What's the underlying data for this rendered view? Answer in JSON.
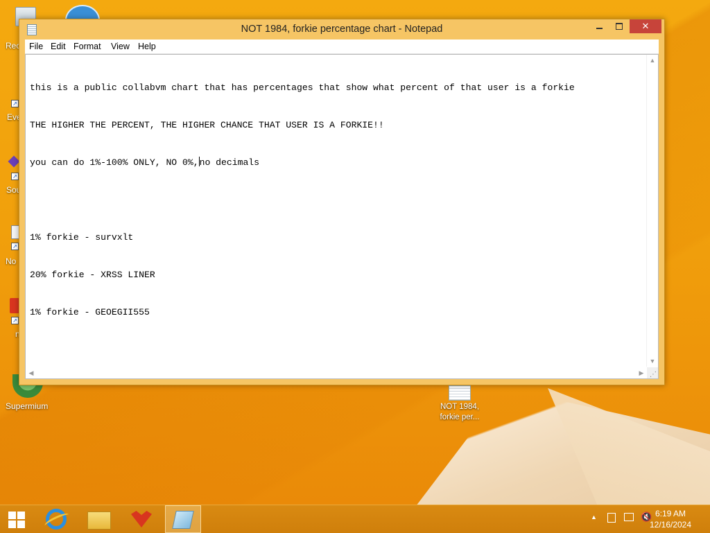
{
  "window": {
    "title": "NOT 1984, forkie percentage chart - Notepad",
    "close_label": "✕",
    "menus": [
      "File",
      "Edit",
      "Format",
      "View",
      "Help"
    ],
    "lines": [
      "this is a public collabvm chart that has percentages that show what percent of that user is a forkie",
      "THE HIGHER THE PERCENT, THE HIGHER CHANCE THAT USER IS A FORKIE!!",
      "you can do 1%-100% ONLY, NO 0%,",
      "",
      "1% forkie - survxlt",
      "20% forkie - XRSS LINER",
      "1% forkie - GEOEGII555"
    ],
    "caret_line_tail": "no decimals"
  },
  "desktop": {
    "icons": [
      {
        "label": "Rec",
        "icon": "recycle-bin-icon"
      },
      {
        "label": "Eve",
        "icon": "shortcut-icon"
      },
      {
        "label": "Sou",
        "icon": "shortcut-icon"
      },
      {
        "label": "No",
        "icon": "shortcut-icon"
      },
      {
        "label": "n",
        "icon": "shortcut-icon"
      },
      {
        "label": "Supermium",
        "icon": "supermium-icon"
      }
    ],
    "file_icon_label_1": "NOT 1984,",
    "file_icon_label_2": "forkie per..."
  },
  "taskbar": {
    "items": [
      "start-icon",
      "internet-explorer-icon",
      "file-explorer-icon",
      "game-icon",
      "notepad-icon"
    ],
    "time": "6:19 AM",
    "date": "12/16/2024"
  }
}
